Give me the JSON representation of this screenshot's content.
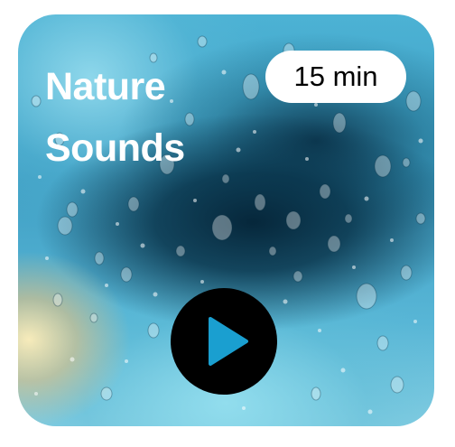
{
  "card": {
    "title": "Nature Sounds",
    "duration": "15 min",
    "background": "rain-on-window-photo",
    "play_icon": "play-icon"
  },
  "colors": {
    "title_text": "#ffffff",
    "pill_background": "#ffffff",
    "pill_text": "#000000",
    "play_button": "#000000",
    "play_icon": "#1a9fd0"
  }
}
